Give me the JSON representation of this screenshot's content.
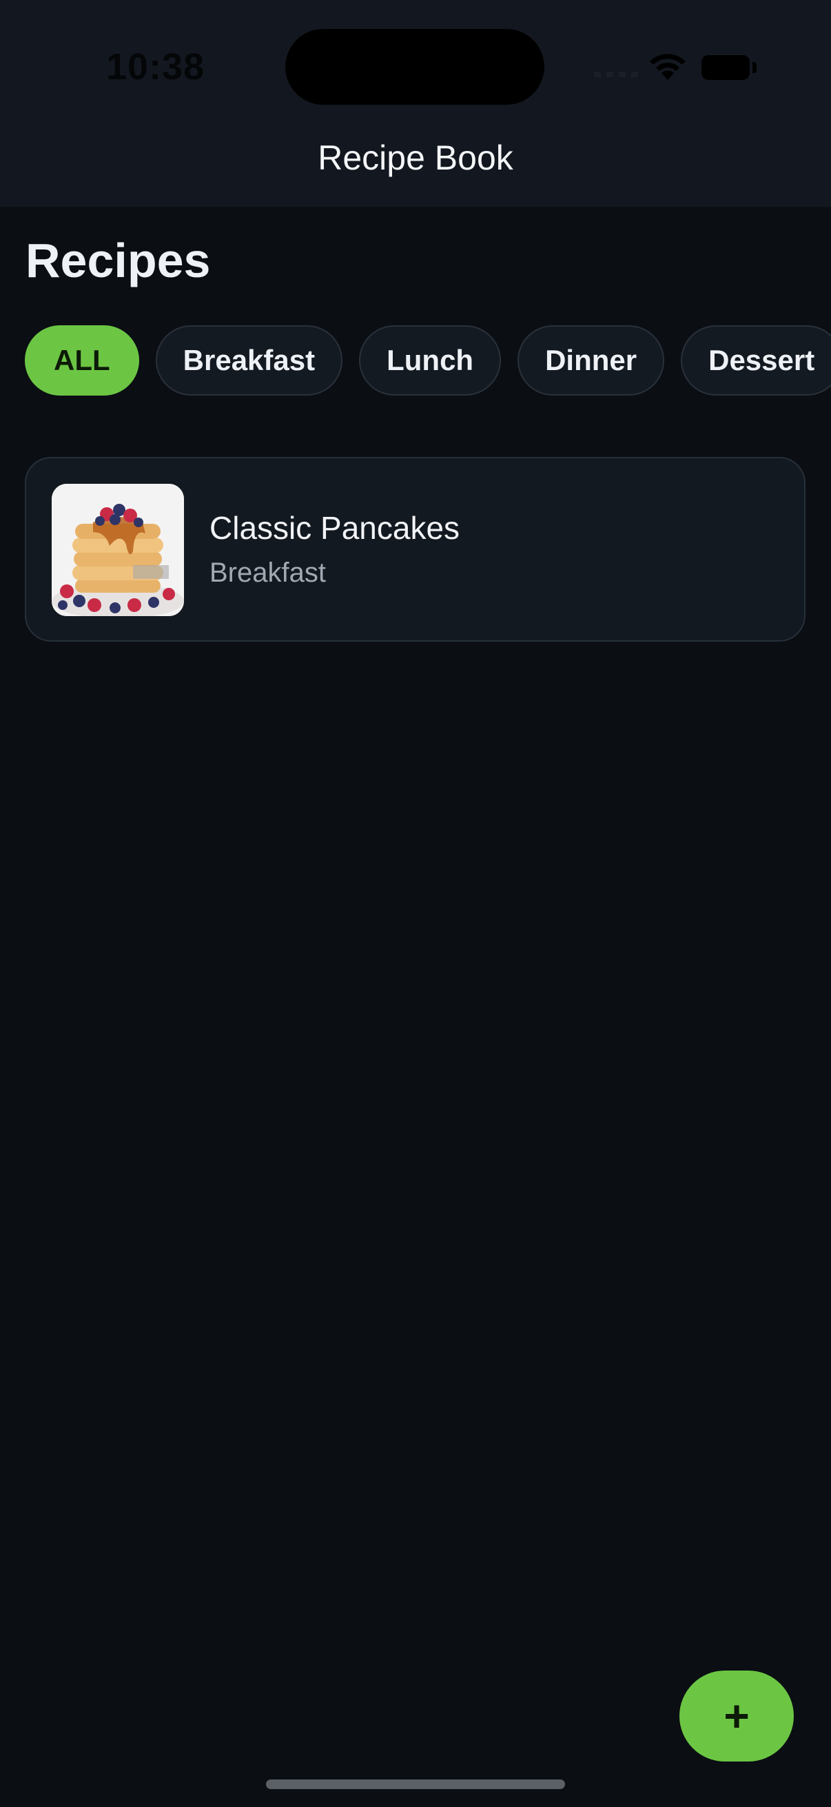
{
  "status_bar": {
    "time": "10:38"
  },
  "nav": {
    "title": "Recipe Book"
  },
  "page": {
    "title": "Recipes"
  },
  "filters": {
    "items": [
      {
        "label": "ALL",
        "active": true
      },
      {
        "label": "Breakfast",
        "active": false
      },
      {
        "label": "Lunch",
        "active": false
      },
      {
        "label": "Dinner",
        "active": false
      },
      {
        "label": "Dessert",
        "active": false
      }
    ]
  },
  "recipes": [
    {
      "title": "Classic Pancakes",
      "category": "Breakfast",
      "image": "pancake-stack-photo"
    }
  ],
  "fab": {
    "label": "+"
  },
  "colors": {
    "accent": "#6cc644",
    "background": "#0b0e13",
    "header": "#131820",
    "card": "#131920"
  }
}
